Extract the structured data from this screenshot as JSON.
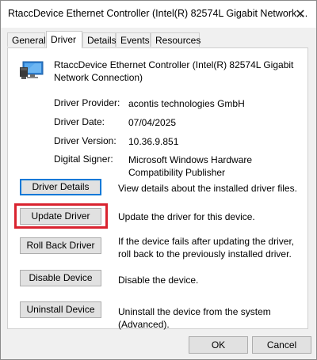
{
  "window": {
    "title": "RtaccDevice Ethernet Controller (Intel(R) 82574L Gigabit Network ...",
    "close_icon": "close-icon"
  },
  "tabs": [
    {
      "label": "General"
    },
    {
      "label": "Driver",
      "active": true
    },
    {
      "label": "Details"
    },
    {
      "label": "Events"
    },
    {
      "label": "Resources"
    }
  ],
  "device": {
    "icon": "network-adapter-icon",
    "name": "RtaccDevice Ethernet Controller (Intel(R) 82574L Gigabit Network Connection)"
  },
  "properties": [
    {
      "label": "Driver Provider:",
      "value": "acontis technologies GmbH"
    },
    {
      "label": "Driver Date:",
      "value": "07/04/2025"
    },
    {
      "label": "Driver Version:",
      "value": "10.36.9.851"
    },
    {
      "label": "Digital Signer:",
      "value": "Microsoft Windows Hardware Compatibility Publisher"
    }
  ],
  "actions": [
    {
      "button": "Driver Details",
      "description": "View details about the installed driver files."
    },
    {
      "button": "Update Driver",
      "description": "Update the driver for this device."
    },
    {
      "button": "Roll Back Driver",
      "description": "If the device fails after updating the driver, roll back to the previously installed driver."
    },
    {
      "button": "Disable Device",
      "description": "Disable the device."
    },
    {
      "button": "Uninstall Device",
      "description": "Uninstall the device from the system (Advanced)."
    }
  ],
  "footer": {
    "ok": "OK",
    "cancel": "Cancel"
  },
  "colors": {
    "highlight": "#d9232f",
    "focus": "#0078d7"
  }
}
